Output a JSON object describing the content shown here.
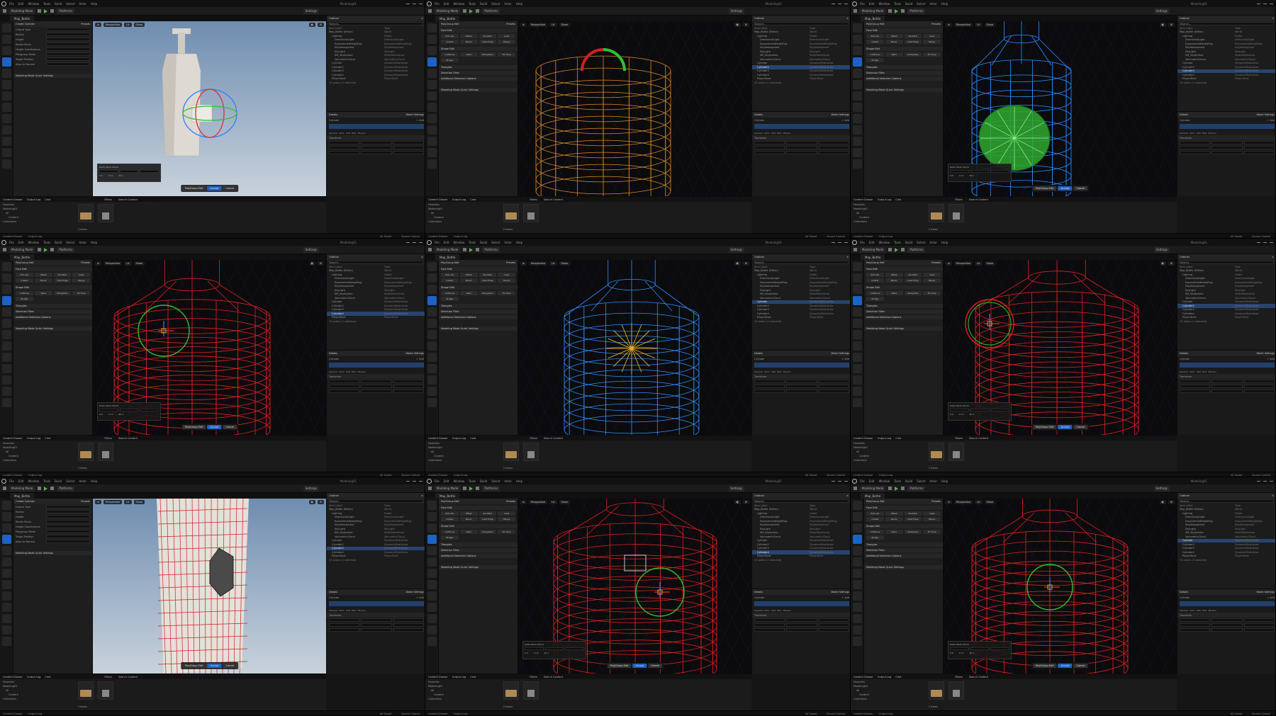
{
  "menu": {
    "items": [
      "File",
      "Edit",
      "Window",
      "Tools",
      "Build",
      "Select",
      "Actor",
      "Help"
    ],
    "project": "Modeling01"
  },
  "toolbar": {
    "mode": "Modeling Mode",
    "platforms": "Platforms",
    "settings": "Settings"
  },
  "level_tab": "Map_Bottle",
  "viewport_top": [
    "Perspective",
    "Lit",
    "Show"
  ],
  "outliner": {
    "title": "Outliner",
    "search_placeholder": "Search...",
    "col_label": "Item Label",
    "col_type": "Type",
    "rows": [
      {
        "name": "Map_Bottle (Editor)",
        "type": "World"
      },
      {
        "name": "Lighting",
        "type": "Folder"
      },
      {
        "name": "DirectionalLight",
        "type": "DirectionalLight"
      },
      {
        "name": "ExponentialHeightFog",
        "type": "ExponentialHeightFog"
      },
      {
        "name": "SkyAtmosphere",
        "type": "SkyAtmosphere"
      },
      {
        "name": "SkyLight",
        "type": "SkyLight"
      },
      {
        "name": "SM_SkySphere",
        "type": "StaticMeshActor"
      },
      {
        "name": "VolumetricCloud",
        "type": "VolumetricCloud"
      },
      {
        "name": "Cylinder",
        "type": "DynamicMeshActor"
      },
      {
        "name": "Cylinder2",
        "type": "DynamicMeshActor"
      },
      {
        "name": "Cylinder3",
        "type": "DynamicMeshActor"
      },
      {
        "name": "Cylinder4",
        "type": "DynamicMeshActor"
      },
      {
        "name": "PlayerStart",
        "type": "PlayerStart"
      }
    ],
    "count": "13 actors (1 selected)"
  },
  "details": {
    "title": "Details",
    "world_settings": "World Settings",
    "actor": "Cylinder",
    "add": "+ Add",
    "component": "Cylinder (Instance)",
    "tabs": [
      "General",
      "Actor",
      "LOD",
      "Misc",
      "Physics",
      "Rendering",
      "Streaming",
      "All"
    ],
    "section": "Transform"
  },
  "left_panel_titles": [
    "Create Cylinder",
    "PolyGroup Edit",
    "PolyGroup Edit",
    "PolyGroup Edit",
    "PolyGroup Edit",
    "PolyGroup Edit",
    "Create Cylinder",
    "PolyGroup Edit",
    "PolyGroup Edit"
  ],
  "left_panel": {
    "presets": "Presets",
    "rows": [
      "Output Type",
      "Radius",
      "Height",
      "Radial Slices",
      "Height Subdivisions",
      "Polygroup Mode",
      "Target Position",
      "Align to Normal"
    ],
    "buttons": [
      "Extrude",
      "Offset",
      "PushPull",
      "Inset",
      "Outset",
      "Bevel",
      "Inset Edge",
      "Merge",
      "CutFaces",
      "Weld",
      "Straighten",
      "Fill Hole",
      "Bridge"
    ],
    "sections": [
      "Face Edit",
      "Shape Edit",
      "Triangles",
      "Selection Filter",
      "Additional Selection Options"
    ],
    "settings": "Modeling Mode Quick Settings"
  },
  "gizmo": {
    "delta": "Delta Mode",
    "world": "World",
    "values": [
      "0.0",
      "17.0",
      "40.1"
    ]
  },
  "accept": {
    "complete": "PolyGroup Edit",
    "accept": "Accept",
    "cancel": "Cancel"
  },
  "content": {
    "tabs": [
      "Content Drawer",
      "Output Log",
      "Cmd"
    ],
    "tree": [
      "Favorites",
      "Modeling01",
      "All",
      "Content",
      "Collections"
    ],
    "filters": "Filters",
    "search_placeholder": "Search Content",
    "count": "2 items"
  },
  "status": {
    "left": "Content Drawer",
    "middle": "Output Log",
    "right": "All Saved",
    "source": "Source Control"
  },
  "colors": {
    "accent": "#1e63c9",
    "wire_red": "#e02020",
    "wire_blue": "#2f8fff",
    "wire_orange": "#d88a2a",
    "gizmo_green": "#2ec02e"
  }
}
